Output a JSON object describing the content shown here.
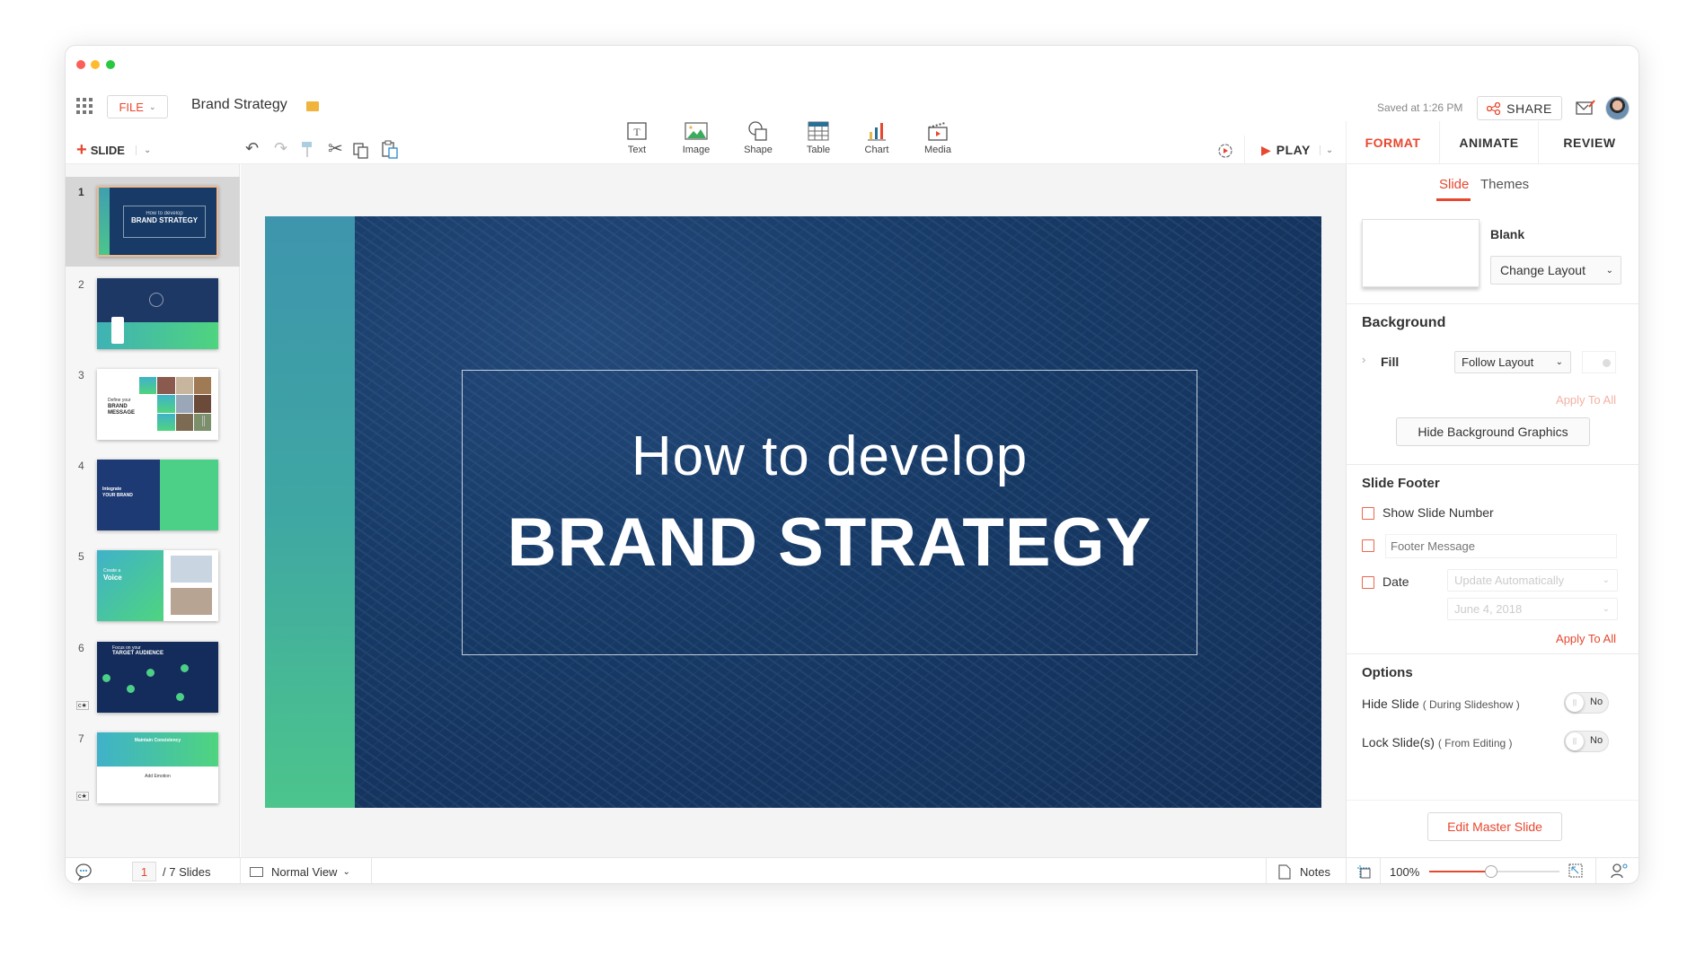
{
  "app": {
    "title": "Brand Strategy",
    "file_menu": "FILE",
    "saved_status": "Saved at 1:26 PM",
    "share_label": "SHARE"
  },
  "toolbar": {
    "new_slide": "SLIDE",
    "insert": [
      {
        "label": "Text",
        "icon": "text-box-icon"
      },
      {
        "label": "Image",
        "icon": "image-icon"
      },
      {
        "label": "Shape",
        "icon": "shape-icon"
      },
      {
        "label": "Table",
        "icon": "table-icon"
      },
      {
        "label": "Chart",
        "icon": "bar-chart-icon"
      },
      {
        "label": "Media",
        "icon": "clapperboard-icon"
      }
    ],
    "play": "PLAY"
  },
  "panel_tabs": [
    "FORMAT",
    "ANIMATE",
    "REVIEW"
  ],
  "colors": {
    "accent": "#e8472f",
    "slide_bg": "#163763",
    "teal": "#3fa0b3",
    "green": "#4ccb86"
  },
  "slides": [
    {
      "number": "1",
      "title_light": "How to develop",
      "title_bold": "BRAND STRATEGY",
      "selected": true
    },
    {
      "number": "2"
    },
    {
      "number": "3",
      "subtitle": "Define your",
      "title": "BRAND MESSAGE"
    },
    {
      "number": "4",
      "subtitle": "Integrate",
      "title": "YOUR BRAND"
    },
    {
      "number": "5",
      "subtitle": "Create a",
      "title": "Voice"
    },
    {
      "number": "6",
      "subtitle": "Focus on your",
      "title": "TARGET AUDIENCE"
    },
    {
      "number": "7",
      "title": "Maintain Consistency",
      "subtitle": "Add Emotion"
    }
  ],
  "main_slide": {
    "line1": "How to develop",
    "line2": "BRAND STRATEGY"
  },
  "format": {
    "subtabs": [
      "Slide",
      "Themes"
    ],
    "active_subtab": "Slide",
    "layout_name": "Blank",
    "change_layout": "Change Layout",
    "background": {
      "heading": "Background",
      "fill_label": "Fill",
      "fill_value": "Follow Layout",
      "apply_all": "Apply To All",
      "hide_graphics": "Hide Background Graphics"
    },
    "footer": {
      "heading": "Slide Footer",
      "show_number": "Show Slide Number",
      "footer_placeholder": "Footer Message",
      "date_label": "Date",
      "date_mode": "Update Automatically",
      "date_value": "June 4, 2018",
      "apply_all": "Apply To All"
    },
    "options": {
      "heading": "Options",
      "hide_slide": "Hide Slide",
      "hide_slide_note": "( During Slideshow )",
      "hide_value": "No",
      "lock_slide": "Lock Slide(s)",
      "lock_slide_note": "( From Editing )",
      "lock_value": "No"
    },
    "edit_master": "Edit Master Slide"
  },
  "statusbar": {
    "current_page": "1",
    "total": "/ 7 Slides",
    "view": "Normal View",
    "notes": "Notes",
    "zoom": "100%",
    "zoom_percent": 100
  }
}
